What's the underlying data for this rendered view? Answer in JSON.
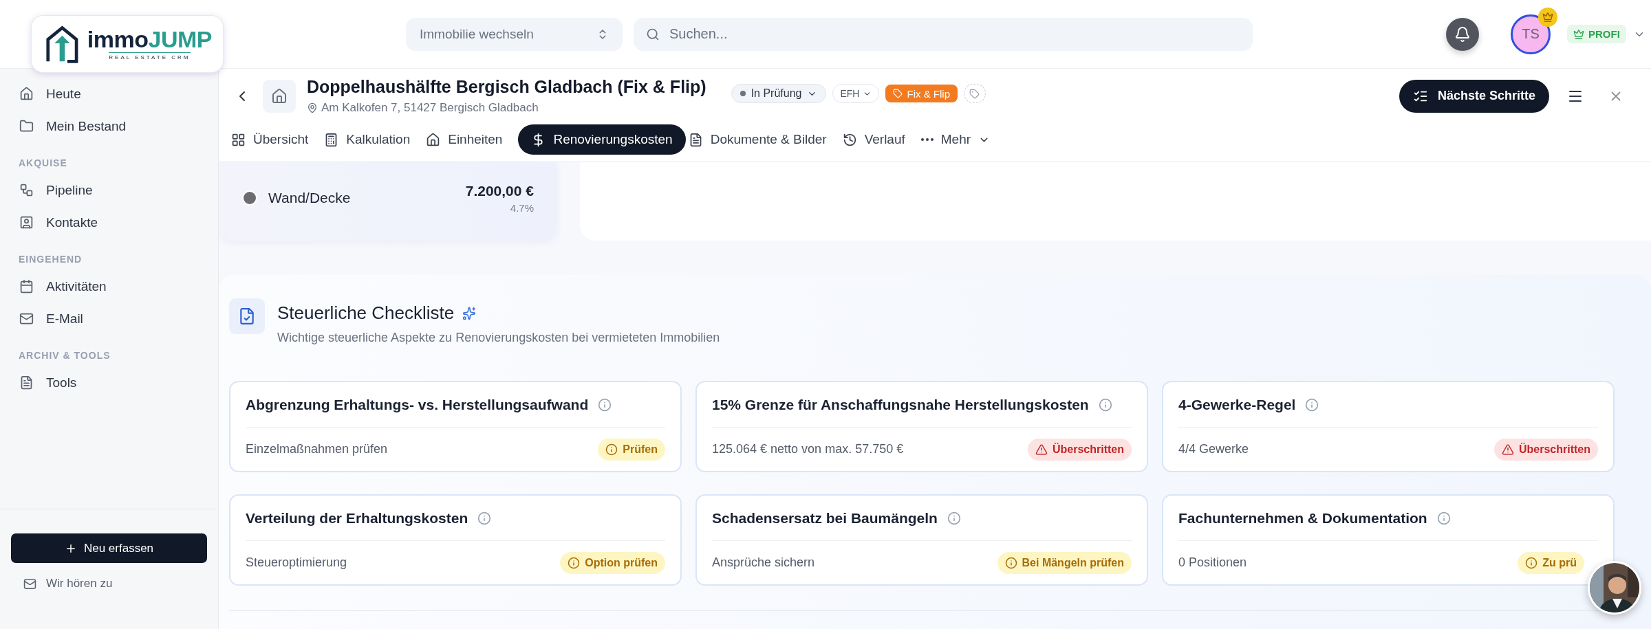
{
  "logo": {
    "word_1": "immo",
    "word_2": "JUMP",
    "tagline": "REAL ESTATE CRM"
  },
  "topbar": {
    "property_switcher": "Immobilie wechseln",
    "search": {
      "placeholder": "Suchen..."
    },
    "avatar_initials": "TS",
    "plan_badge": "PROFI"
  },
  "sidebar": {
    "groups": [
      {
        "items": [
          "Heute",
          "Mein Bestand"
        ]
      },
      {
        "heading": "AKQUISE",
        "items": [
          "Pipeline",
          "Kontakte"
        ]
      },
      {
        "heading": "EINGEHEND",
        "items": [
          "Aktivitäten",
          "E-Mail"
        ]
      },
      {
        "heading": "ARCHIV & TOOLS",
        "items": [
          "Tools"
        ]
      }
    ],
    "new_button": "Neu erfassen",
    "feedback_link": "Wir hören zu"
  },
  "property": {
    "title": "Doppelhaushälfte Bergisch Gladbach (Fix & Flip)",
    "address": "Am Kalkofen 7, 51427 Bergisch Gladbach",
    "status": "In Prüfung",
    "type": "EFH",
    "tag": "Fix & Flip",
    "next_steps_button": "Nächste Schritte"
  },
  "tabs": [
    {
      "label": "Übersicht",
      "selected": false,
      "kind": "page"
    },
    {
      "label": "Kalkulation",
      "selected": false,
      "kind": "page"
    },
    {
      "label": "Einheiten",
      "selected": false,
      "kind": "page"
    },
    {
      "label": "Renovierungskosten",
      "selected": true,
      "kind": "page"
    },
    {
      "label": "Dokumente & Bilder",
      "selected": false,
      "kind": "page"
    },
    {
      "label": "Verlauf",
      "selected": false,
      "kind": "page"
    },
    {
      "label": "Mehr",
      "selected": false,
      "kind": "menu"
    }
  ],
  "cost_items": [
    {
      "label": "Wand/Decke",
      "amount": "7.200,00 €",
      "share": "4.7%",
      "color": "#6b6b70"
    }
  ],
  "checklist": {
    "title": "Steuerliche Checkliste",
    "subtitle": "Wichtige steuerliche Aspekte zu Renovierungskosten bei vermieteten Immobilien",
    "items": [
      {
        "title": "Abgrenzung Erhaltungs- vs. Herstellungsaufwand",
        "detail": "Einzelmaßnahmen prüfen",
        "status": "Prüfen",
        "kind": "check"
      },
      {
        "title": "15% Grenze für Anschaffungsnahe Herstellungskosten",
        "detail": "125.064 € netto von max. 57.750 €",
        "status": "Überschritten",
        "kind": "exceeded"
      },
      {
        "title": "4-Gewerke-Regel",
        "detail": "4/4 Gewerke",
        "status": "Überschritten",
        "kind": "exceeded"
      },
      {
        "title": "Verteilung der Erhaltungskosten",
        "detail": "Steueroptimierung",
        "status": "Option prüfen",
        "kind": "check"
      },
      {
        "title": "Schadensersatz bei Baumängeln",
        "detail": "Ansprüche sichern",
        "status": "Bei Mängeln prüfen",
        "kind": "check"
      },
      {
        "title": "Fachunternehmen & Dokumentation",
        "detail": "0 Positionen",
        "status": "Zu prü",
        "kind": "check"
      }
    ]
  }
}
